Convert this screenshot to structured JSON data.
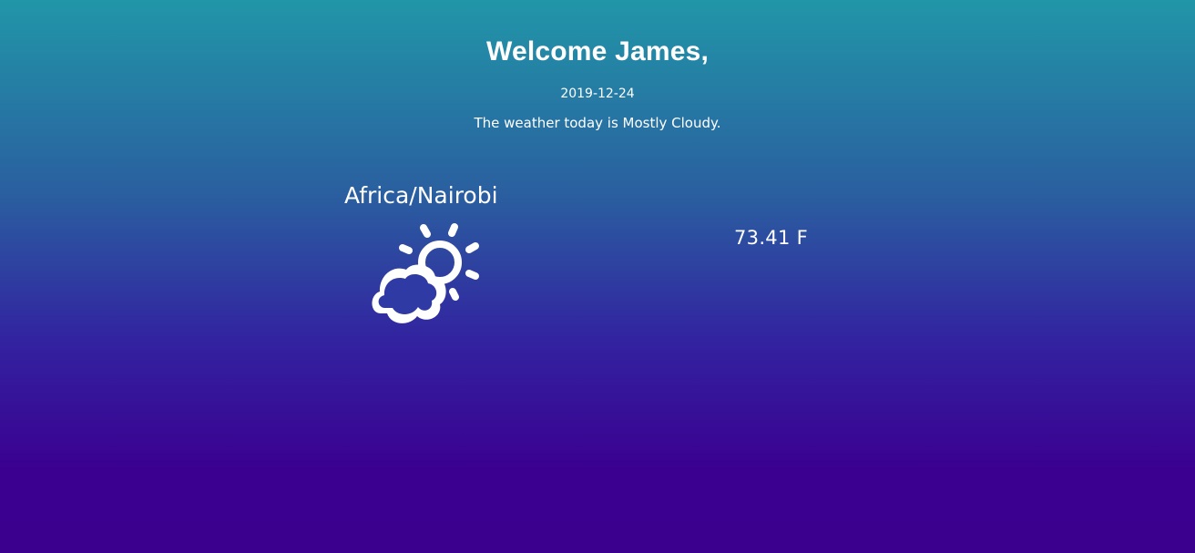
{
  "header": {
    "greeting": "Welcome James,",
    "date": "2019-12-24",
    "summary": "The weather today is Mostly Cloudy."
  },
  "weather": {
    "location": "Africa/Nairobi",
    "icon": "partly-cloudy-day-icon",
    "temperature": "73.41 F"
  },
  "colors": {
    "gradient_top": "#2196a8",
    "gradient_bottom": "#3c008f",
    "text": "#ffffff"
  }
}
